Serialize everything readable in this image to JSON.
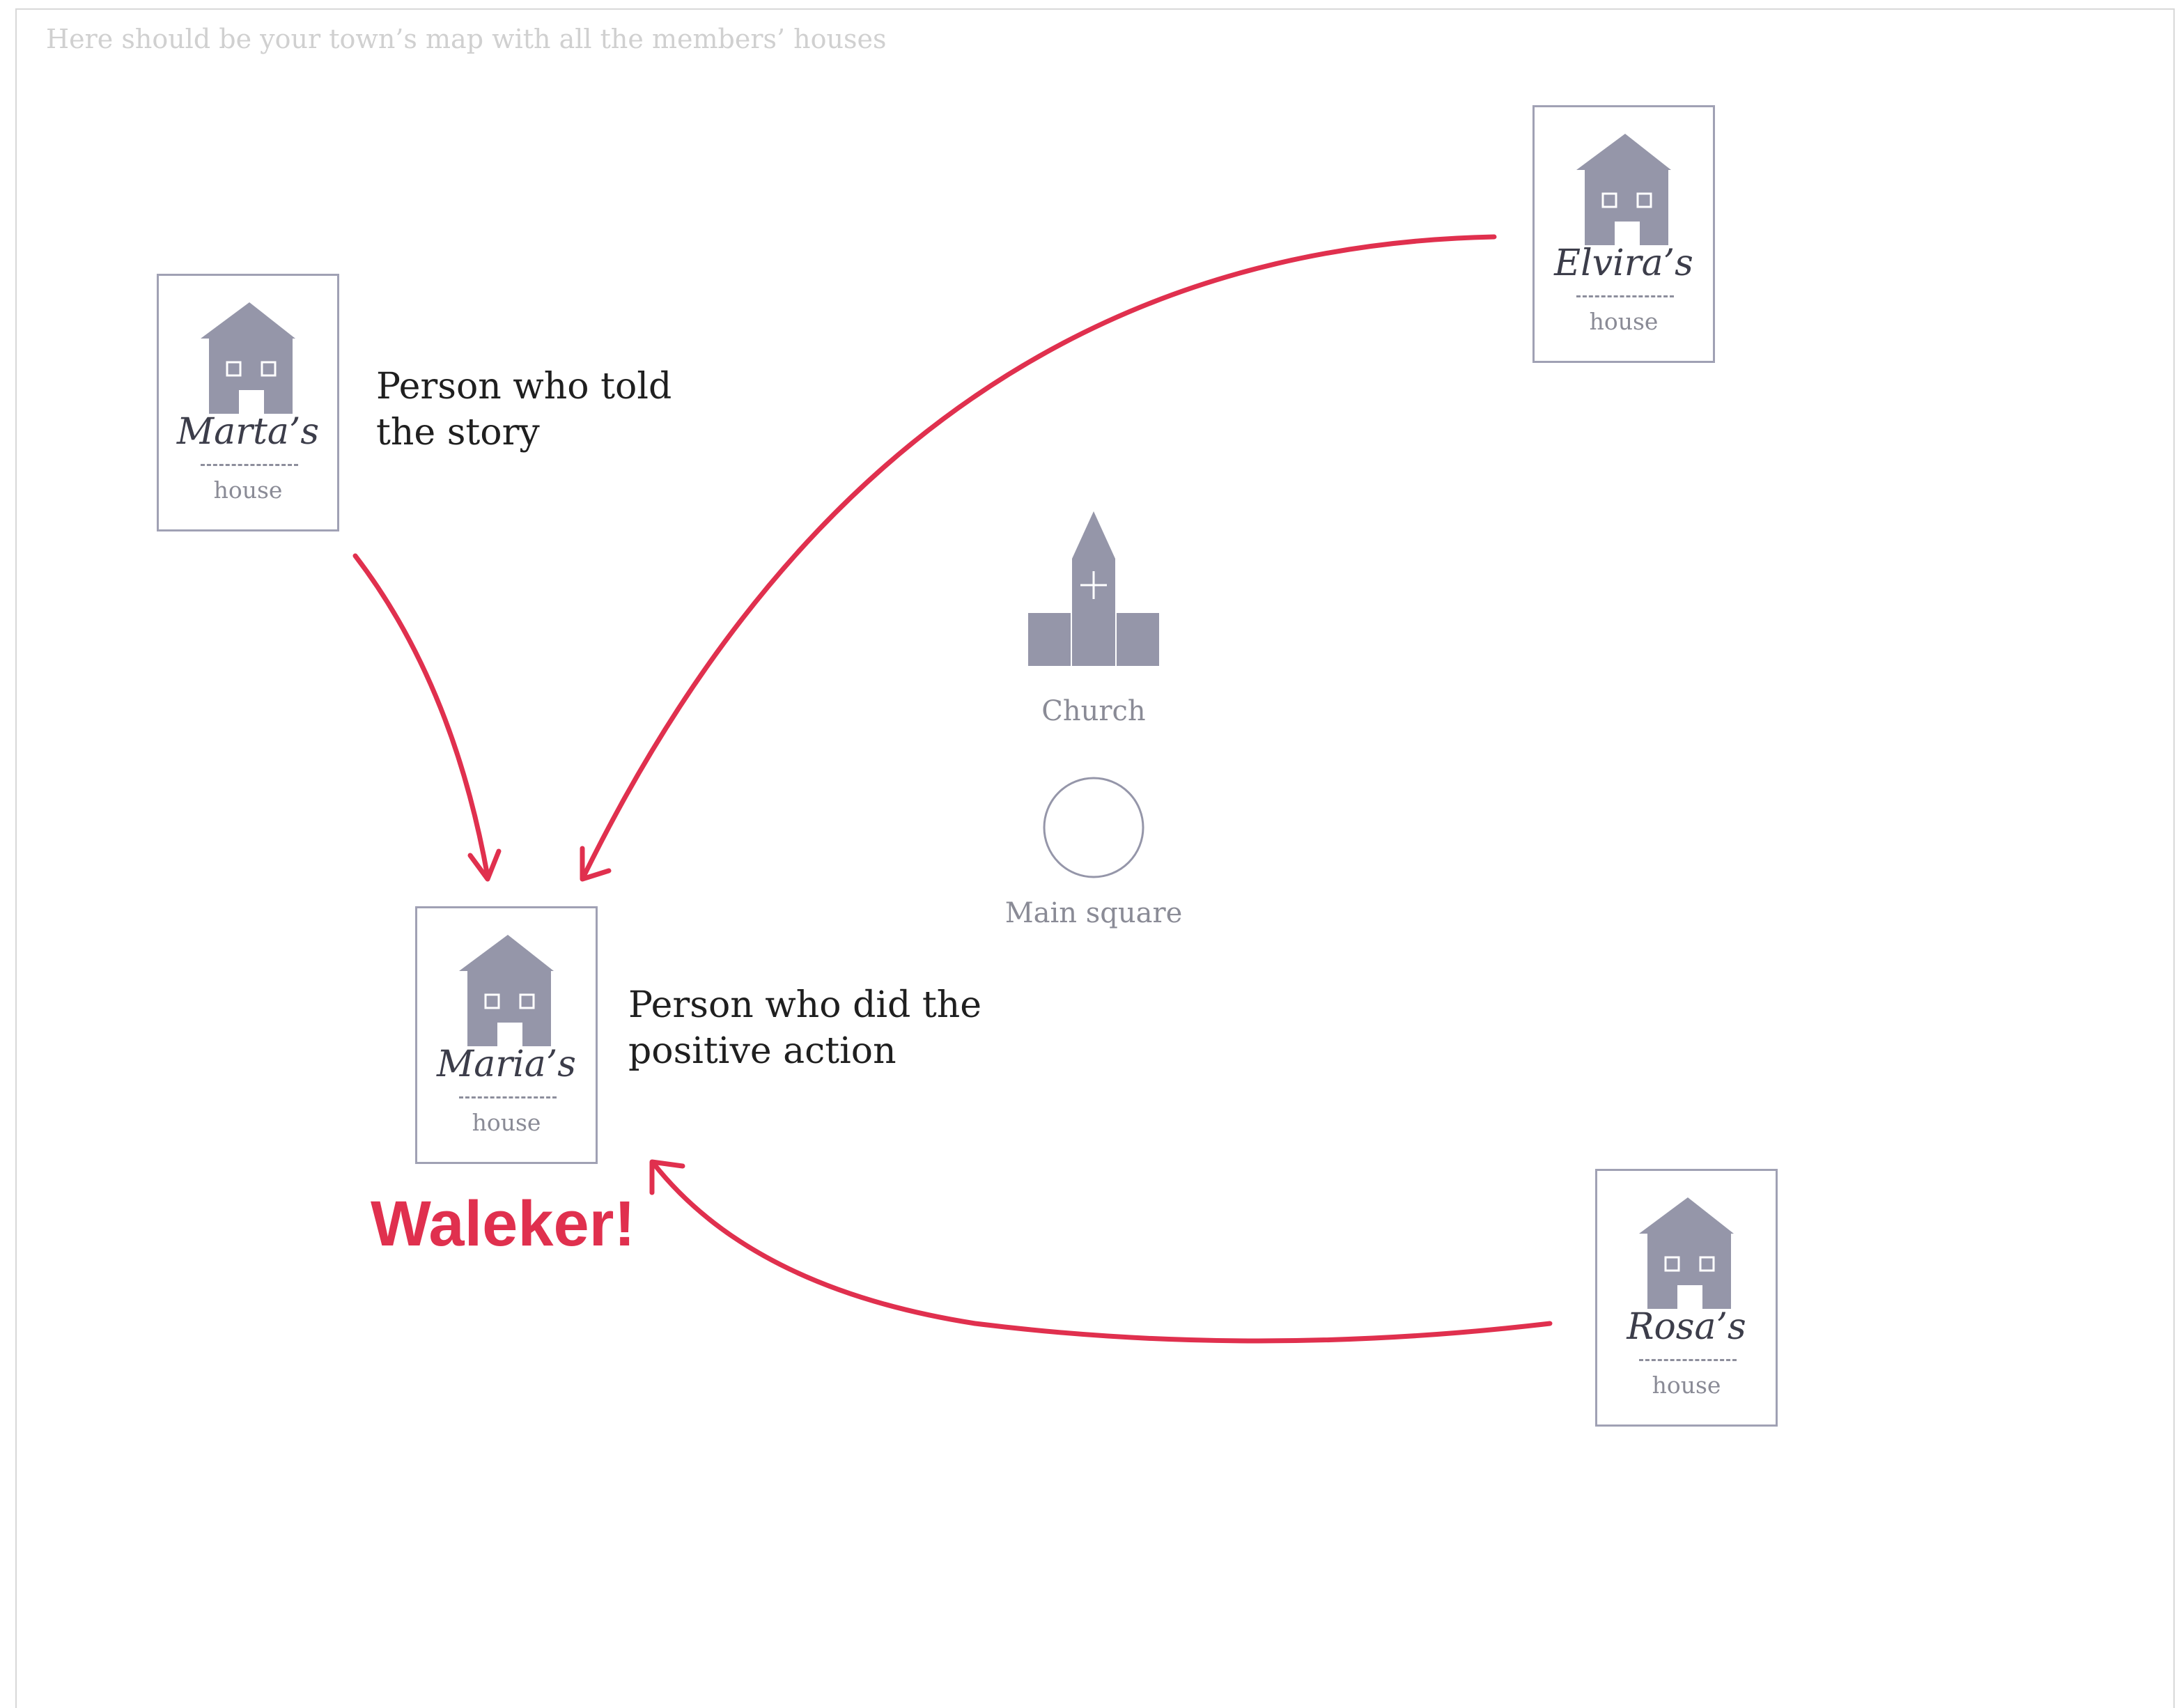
{
  "map": {
    "hint": "Here should be your town’s map with all the members’ houses"
  },
  "houses": {
    "marta": {
      "owner": "Marta’s",
      "label": "house"
    },
    "elvira": {
      "owner": "Elvira’s",
      "label": "house"
    },
    "maria": {
      "owner": "Maria’s",
      "label": "house"
    },
    "rosa": {
      "owner": "Rosa’s",
      "label": "house"
    }
  },
  "captions": {
    "storyteller": "Person who told\nthe story",
    "actor": "Person who did the\npositive action"
  },
  "landmarks": {
    "church": "Church",
    "square": "Main square"
  },
  "callout": "Waleker!",
  "colors": {
    "house_fill": "#9596a9",
    "card_border": "#a0a1b4",
    "arrow": "#e0304e",
    "muted_text": "#8a8b96"
  }
}
